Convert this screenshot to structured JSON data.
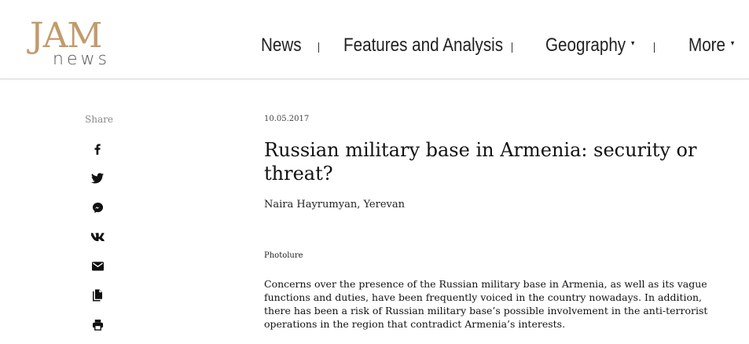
{
  "logo": {
    "top": "JAM",
    "bottom": "news"
  },
  "nav": {
    "items": [
      {
        "label": "News"
      },
      {
        "label": "Features and Analysis"
      },
      {
        "label": "Geography",
        "caret": "▾"
      },
      {
        "label": "More",
        "caret": "▾"
      }
    ]
  },
  "share": {
    "label": "Share",
    "icons": [
      "facebook-icon",
      "twitter-icon",
      "messenger-icon",
      "vk-icon",
      "email-icon",
      "copy-icon",
      "print-icon"
    ]
  },
  "article": {
    "date": "10.05.2017",
    "title": "Russian military base in Armenia: security or threat?",
    "author": "Naira Hayrumyan, Yerevan",
    "photo_credit": "Photolure",
    "lead": "Concerns over the presence of the Russian military base in Armenia, as well as its vague functions and duties, have been frequently voiced in the country nowadays. In addition, there has been a risk of Russian military base’s possible  involvement in the anti-terrorist operations in the region that contradict Armenia’s interests."
  },
  "colors": {
    "brand": "#c29b6a",
    "text": "#111111",
    "muted": "#888888"
  }
}
